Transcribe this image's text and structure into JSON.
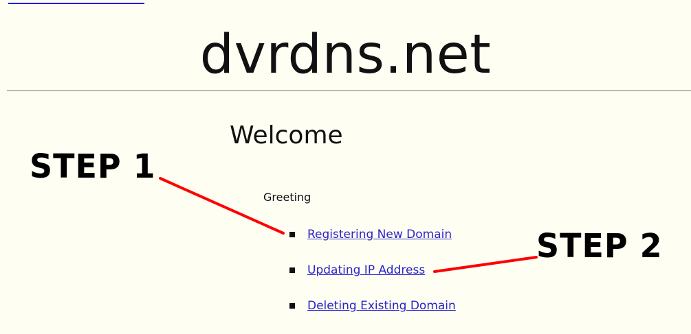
{
  "header": {
    "title": "dvrdns.net"
  },
  "main": {
    "heading": "Welcome",
    "greeting": "Greeting",
    "links": [
      {
        "label": "Registering New Domain"
      },
      {
        "label": "Updating IP Address"
      },
      {
        "label": "Deleting Existing Domain"
      }
    ]
  },
  "annotations": {
    "step1": "STEP 1",
    "step2": "STEP 2",
    "arrow_color": "#ff0000"
  },
  "colors": {
    "background": "#fefef3",
    "link": "#2a24c8",
    "rule": "#b8b8b8",
    "text": "#111111"
  }
}
